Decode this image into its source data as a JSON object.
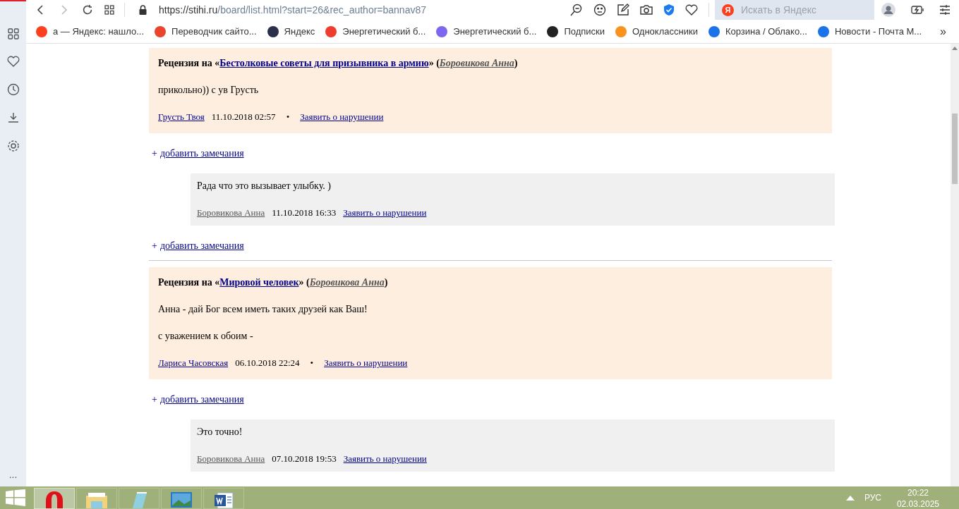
{
  "browser": {
    "url_host": "https://stihi.ru",
    "url_path": "/board/list.html?start=26&rec_author=bannav87",
    "search_placeholder": "Искать в Яндекс",
    "search_logo": "Я"
  },
  "bookmarks": [
    {
      "label": "а — Яндекс: нашло...",
      "color": "#fc3f1d"
    },
    {
      "label": "Переводчик сайто...",
      "color": "#e8452c"
    },
    {
      "label": "Яндекс",
      "color": "#2b2f4a"
    },
    {
      "label": "Энергетический б...",
      "color": "#f03b2f"
    },
    {
      "label": "Энергетический б...",
      "color": "#7b68ee"
    },
    {
      "label": "Подписки",
      "color": "#222222"
    },
    {
      "label": "Одноклассники",
      "color": "#f7931e"
    },
    {
      "label": "Корзина / Облако...",
      "color": "#1a73e8"
    },
    {
      "label": "Новости - Почта М...",
      "color": "#1a73e8"
    }
  ],
  "bookmarks_more": "»",
  "feed": [
    {
      "kind": "review",
      "prefix": "Рецензия на «",
      "work": "Бестолковые советы для призывника в армию",
      "mid": "» (",
      "author": "Боровикова Анна",
      "suffix": ")",
      "paragraphs": [
        "прикольно)) с ув Грусть"
      ],
      "by": "Грусть Твоя",
      "date": "11.10.2018 02:57",
      "sep": "•",
      "report": "Заявить о нарушении"
    },
    {
      "kind": "add",
      "plus": "+",
      "label": "добавить замечания"
    },
    {
      "kind": "reply",
      "text": "Рада что это вызывает улыбку. )",
      "by": "Боровикова Анна",
      "date": "11.10.2018 16:33",
      "report": "Заявить о нарушении"
    },
    {
      "kind": "add",
      "plus": "+",
      "label": "добавить замечания"
    },
    {
      "kind": "divider"
    },
    {
      "kind": "review",
      "prefix": "Рецензия на «",
      "work": "Мировой человек",
      "mid": "» (",
      "author": "Боровикова Анна",
      "suffix": ")",
      "paragraphs": [
        "Анна - дай Бог всем иметь таких друзей как Ваш!",
        "с уважением к обоим -"
      ],
      "by": "Лариса Часовская",
      "date": "06.10.2018 22:24",
      "sep": "•",
      "report": "Заявить о нарушении"
    },
    {
      "kind": "add",
      "plus": "+",
      "label": "добавить замечания"
    },
    {
      "kind": "reply",
      "text": "Это точно!",
      "by": "Боровикова Анна",
      "date": "07.10.2018 19:53",
      "report": "Заявить о нарушении"
    }
  ],
  "sidebar_more": "...",
  "taskbar": {
    "language": "РУС",
    "time": "20:22",
    "date": "02.03.2025"
  }
}
